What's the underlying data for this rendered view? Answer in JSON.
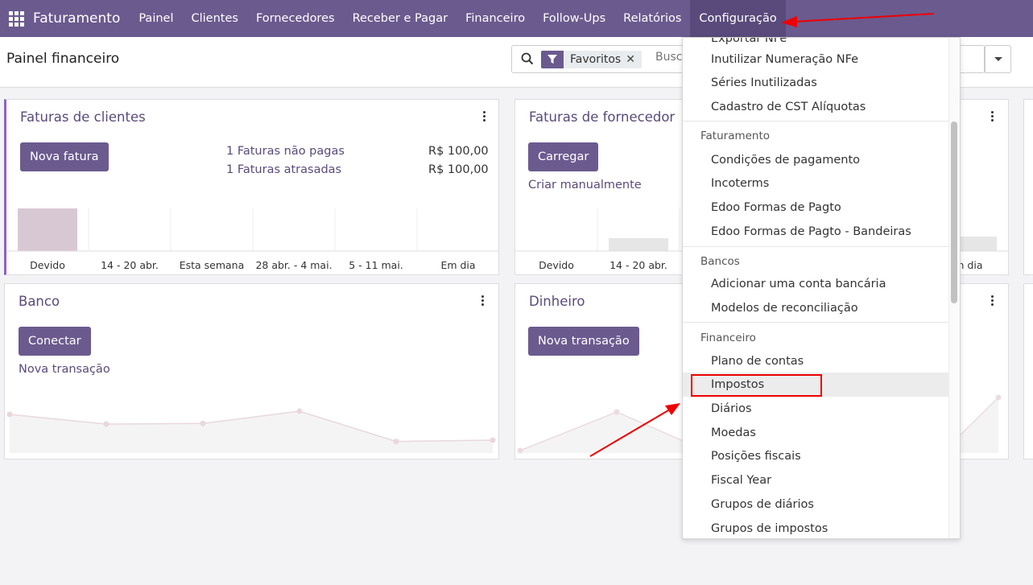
{
  "navbar": {
    "brand": "Faturamento",
    "items": [
      "Painel",
      "Clientes",
      "Fornecedores",
      "Receber e Pagar",
      "Financeiro",
      "Follow-Ups",
      "Relatórios",
      "Configuração"
    ],
    "active": "Configuração",
    "color": "#6b5a8e"
  },
  "control": {
    "title": "Painel financeiro",
    "facet_label": "Favoritos",
    "search_placeholder": "Busc"
  },
  "cards": {
    "customer_invoices": {
      "title": "Faturas de clientes",
      "button": "Nova fatura",
      "unpaid_label": "1 Faturas não pagas",
      "unpaid_amount": "R$ 100,00",
      "late_label": "1 Faturas atrasadas",
      "late_amount": "R$ 100,00",
      "chart_labels": [
        "Devido",
        "14 - 20 abr.",
        "Esta semana",
        "28 abr. - 4 mai.",
        "5 - 11 mai.",
        "Em dia"
      ]
    },
    "vendor_bills": {
      "title": "Faturas de fornecedor",
      "button": "Carregar",
      "link": "Criar manualmente",
      "chart_labels": [
        "Devido",
        "14 - 20 abr."
      ],
      "chart_label_right": "n dia"
    },
    "bank": {
      "title": "Banco",
      "button": "Conectar",
      "link": "Nova transação"
    },
    "cash": {
      "title": "Dinheiro",
      "button": "Nova transação"
    }
  },
  "chart_data": [
    {
      "type": "bar",
      "categories": [
        "Devido",
        "14 - 20 abr.",
        "Esta semana",
        "28 abr. - 4 mai.",
        "5 - 11 mai.",
        "Em dia"
      ],
      "values": [
        100,
        0,
        0,
        0,
        0,
        0
      ],
      "ylim": [
        0,
        100
      ],
      "colors": [
        "#d8c8d3"
      ]
    },
    {
      "type": "line",
      "values": [
        60,
        45,
        46,
        65,
        18,
        20
      ],
      "ylim": [
        0,
        100
      ],
      "color": "#e8d8de"
    }
  ],
  "dropdown": {
    "cut_top_item": "Exportar NFe",
    "groups": [
      {
        "header": "",
        "items": [
          "Inutilizar Numeração NFe",
          "Séries Inutilizadas",
          "Cadastro de CST Alíquotas"
        ]
      },
      {
        "header": "Faturamento",
        "items": [
          "Condições de pagamento",
          "Incoterms",
          "Edoo Formas de Pagto",
          "Edoo Formas de Pagto - Bandeiras"
        ]
      },
      {
        "header": "Bancos",
        "items": [
          "Adicionar uma conta bancária",
          "Modelos de reconciliação"
        ]
      },
      {
        "header": "Financeiro",
        "items": [
          "Plano de contas",
          "Impostos",
          "Diários",
          "Moedas",
          "Posições fiscais",
          "Fiscal Year",
          "Grupos de diários",
          "Grupos de impostos"
        ]
      }
    ],
    "highlighted": "Impostos"
  },
  "annotation_color": "#e00000"
}
